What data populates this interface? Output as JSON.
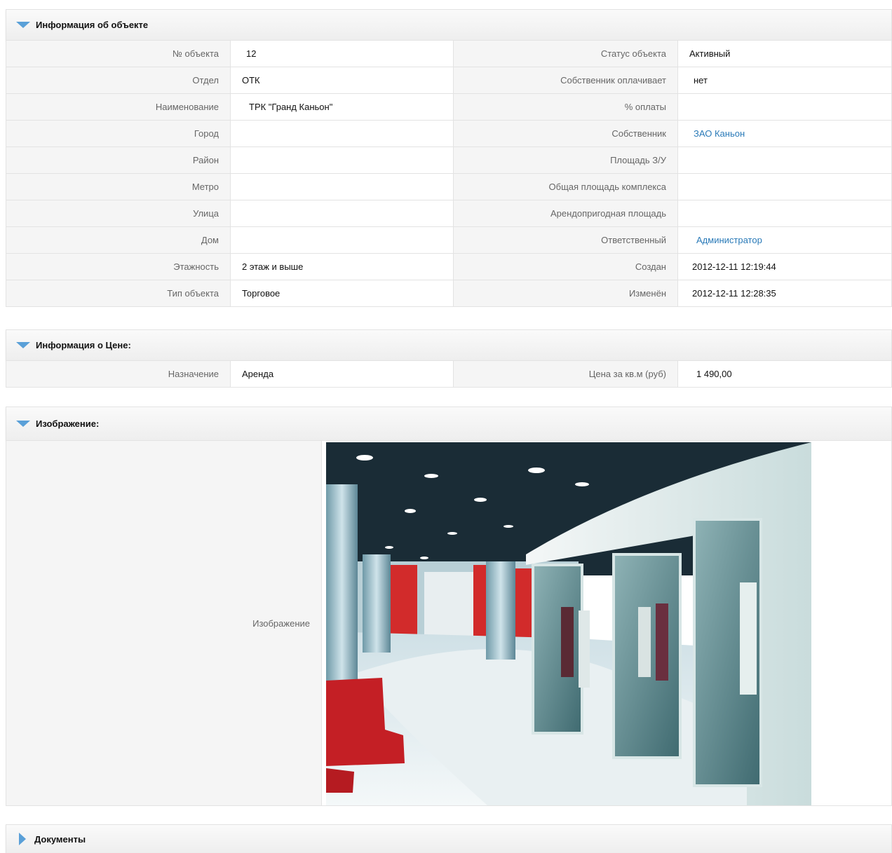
{
  "object_panel": {
    "title": "Информация об объекте",
    "rows": [
      {
        "l1": "№ объекта",
        "v1": "12",
        "l2": "Статус объекта",
        "v2": "Активный"
      },
      {
        "l1": "Отдел",
        "v1": "ОТК",
        "l2": "Собственник оплачивает",
        "v2": "нет"
      },
      {
        "l1": "Наименование",
        "v1": "ТРК \"Гранд Каньон\"",
        "l2": "% оплаты",
        "v2": ""
      },
      {
        "l1": "Город",
        "v1": "",
        "l2": "Собственник",
        "v2": "ЗАО Каньон"
      },
      {
        "l1": "Район",
        "v1": "",
        "l2": "Площадь З/У",
        "v2": ""
      },
      {
        "l1": "Метро",
        "v1": "",
        "l2": "Общая площадь комплекса",
        "v2": ""
      },
      {
        "l1": "Улица",
        "v1": "",
        "l2": "Арендопригодная площадь",
        "v2": ""
      },
      {
        "l1": "Дом",
        "v1": "",
        "l2": "Ответственный",
        "v2": "Администратор"
      },
      {
        "l1": "Этажность",
        "v1": "2 этаж и выше",
        "l2": "Создан",
        "v2": "2012-12-11 12:19:44"
      },
      {
        "l1": "Тип объекта",
        "v1": "Торговое",
        "l2": "Изменён",
        "v2": "2012-12-11 12:28:35"
      }
    ]
  },
  "price_panel": {
    "title": "Информация о Цене:",
    "rows": [
      {
        "l1": "Назначение",
        "v1": "Аренда",
        "l2": "Цена за кв.м (руб)",
        "v2": "1 490,00"
      }
    ]
  },
  "image_panel": {
    "title": "Изображение:",
    "label": "Изображение"
  },
  "documents_panel": {
    "title": "Документы"
  },
  "colors": {
    "link": "#2a7ab8",
    "accent_triangle": "#5aa0d8"
  },
  "icons": {
    "expanded": "triangle-down-icon",
    "collapsed": "triangle-right-icon"
  }
}
